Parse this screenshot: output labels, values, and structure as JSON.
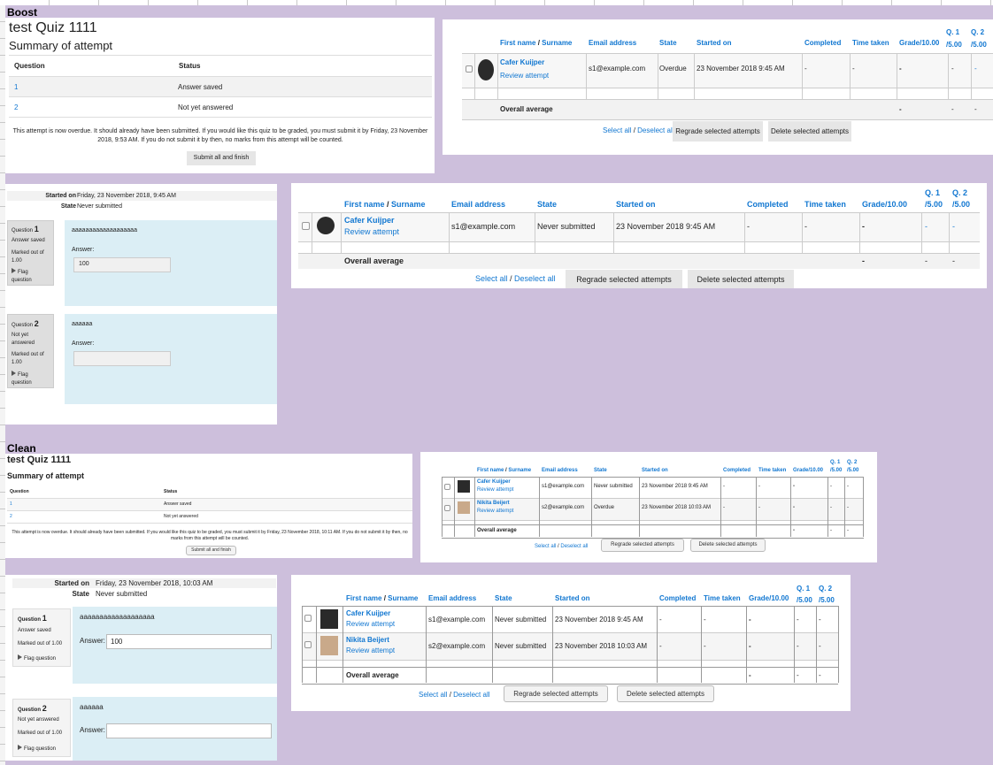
{
  "sections": {
    "boost": "Boost",
    "clean": "Clean"
  },
  "quiz_title": "test Quiz 1111",
  "summary_heading": "Summary of attempt",
  "summary_table": {
    "col_question": "Question",
    "col_status": "Status"
  },
  "boost_summary": {
    "rows": [
      {
        "q": "1",
        "status": "Answer saved"
      },
      {
        "q": "2",
        "status": "Not yet answered"
      }
    ],
    "overdue_text": "This attempt is now overdue. It should already have been submitted. If you would like this quiz to be graded, you must submit it by Friday, 23 November 2018, 9:53 AM. If you do not submit it by then, no marks from this attempt will be counted.",
    "submit_label": "Submit all and finish"
  },
  "clean_summary": {
    "rows": [
      {
        "q": "1",
        "status": "Answer saved"
      },
      {
        "q": "2",
        "status": "Not yet answered"
      }
    ],
    "overdue_text": "This attempt is now overdue. It should already have been submitted. If you would like this quiz to be graded, you must submit it by Friday, 23 November 2018, 10:11 AM. If you do not submit it by then, no marks from this attempt will be counted.",
    "submit_label": "Submit all and finish"
  },
  "attempt_headers": {
    "first_name": "First name",
    "sep": " / ",
    "surname": "Surname",
    "email": "Email address",
    "state": "State",
    "started": "Started on",
    "completed": "Completed",
    "time_taken": "Time taken",
    "grade": "Grade/10.00",
    "q1": "Q. 1",
    "q1_sub": "/5.00",
    "q2": "Q. 2",
    "q2_sub": "/5.00"
  },
  "users": {
    "cafer": {
      "name": "Cafer Kuijper",
      "email": "s1@example.com",
      "review": "Review attempt",
      "started": "23 November 2018 9:45 AM"
    },
    "nikita": {
      "name": "Nikita Beijert",
      "email": "s2@example.com",
      "review": "Review attempt",
      "started": "23 November 2018 10:03 AM"
    }
  },
  "states": {
    "overdue": "Overdue",
    "never": "Never submitted"
  },
  "dash": "-",
  "overall_average": "Overall average",
  "select_all": "Select all",
  "slash": " / ",
  "deselect_all": "Deselect all",
  "regrade_label": "Regrade selected attempts",
  "delete_label": "Delete selected attempts",
  "review_boost": {
    "started_label": "Started on",
    "started_value": "Friday, 23 November 2018, 9:45 AM",
    "state_label": "State",
    "state_value": "Never submitted"
  },
  "review_clean": {
    "started_label": "Started on",
    "started_value": "Friday, 23 November 2018, 10:03 AM",
    "state_label": "State",
    "state_value": "Never submitted"
  },
  "question_word": "Question",
  "q1": {
    "num": "1",
    "status": "Answer saved",
    "marked": "Marked out of 1.00",
    "flag": "Flag question",
    "text": "aaaaaaaaaaaaaaaaaaa",
    "answer_label": "Answer:",
    "answer_value": "100"
  },
  "q2": {
    "num": "2",
    "status": "Not yet answered",
    "marked": "Marked out of 1.00",
    "flag": "Flag question",
    "text": "aaaaaa",
    "answer_label": "Answer:",
    "answer_value": ""
  },
  "q1_boost_status_lines": [
    "Answer saved"
  ],
  "q2_boost_status_lines": [
    "Not yet",
    "answered"
  ],
  "boost_marked_lines": [
    "Marked out of",
    "1.00"
  ],
  "boost_flag_lines": [
    "Flag",
    "question"
  ]
}
